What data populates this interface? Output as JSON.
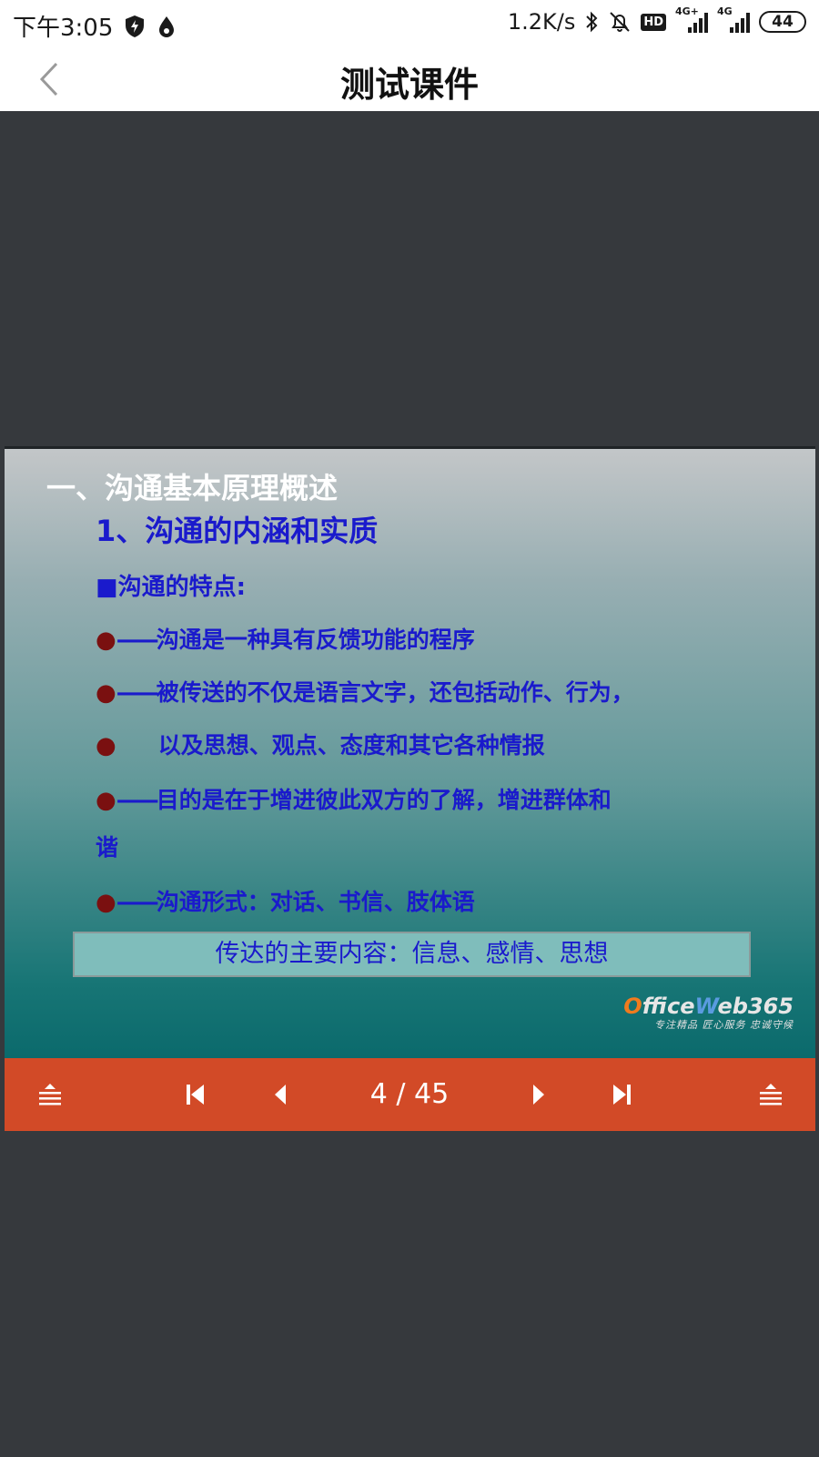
{
  "status_bar": {
    "time": "下午3:05",
    "net_speed": "1.2K/s",
    "hd_label": "HD",
    "sig1_label": "4G+",
    "sig2_label": "4G",
    "battery": "44"
  },
  "nav": {
    "title": "测试课件"
  },
  "slide": {
    "heading": "一、沟通基本原理概述",
    "subheading": "1、沟通的内涵和实质",
    "features_label": "■沟通的特点:",
    "bullets": [
      {
        "dot": "●",
        "dash": "——",
        "text": "沟通是一种具有反馈功能的程序"
      },
      {
        "dot": "●",
        "dash": "——",
        "text": "被传送的不仅是语言文字，还包括动作、行为，"
      },
      {
        "dot": "●",
        "dash": "",
        "text": "以及思想、观点、态度和其它各种情报"
      },
      {
        "dot": "●",
        "dash": "——",
        "text": "目的是在于增进彼此双方的了解，增进群体和"
      },
      {
        "dot": "",
        "dash": "",
        "text": "谐"
      },
      {
        "dot": "●",
        "dash": "——",
        "text": "沟通形式：对话、书信、肢体语"
      }
    ],
    "box_text": "传达的主要内容：信息、感情、思想",
    "logo": {
      "o_letter": "O",
      "o_rest": "ffice",
      "w_letter": "W",
      "w_rest": "eb365",
      "tagline": "专注精品  匠心服务  忠诚守候"
    }
  },
  "controls": {
    "page_indicator": "4 / 45"
  },
  "colors": {
    "control_bar": "#d24a27",
    "slide_text": "#1a1acc",
    "viewer_bg": "#36393d"
  }
}
